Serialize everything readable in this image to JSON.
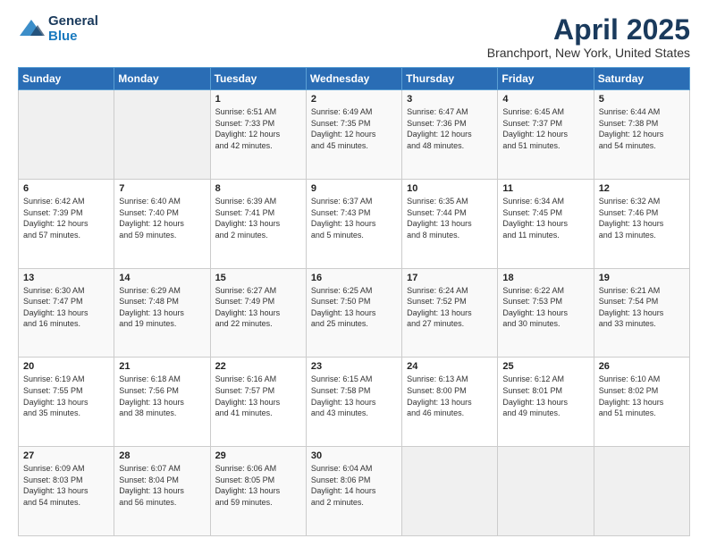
{
  "logo": {
    "general": "General",
    "blue": "Blue"
  },
  "header": {
    "title": "April 2025",
    "subtitle": "Branchport, New York, United States"
  },
  "days_of_week": [
    "Sunday",
    "Monday",
    "Tuesday",
    "Wednesday",
    "Thursday",
    "Friday",
    "Saturday"
  ],
  "weeks": [
    [
      {
        "day": "",
        "info": ""
      },
      {
        "day": "",
        "info": ""
      },
      {
        "day": "1",
        "info": "Sunrise: 6:51 AM\nSunset: 7:33 PM\nDaylight: 12 hours\nand 42 minutes."
      },
      {
        "day": "2",
        "info": "Sunrise: 6:49 AM\nSunset: 7:35 PM\nDaylight: 12 hours\nand 45 minutes."
      },
      {
        "day": "3",
        "info": "Sunrise: 6:47 AM\nSunset: 7:36 PM\nDaylight: 12 hours\nand 48 minutes."
      },
      {
        "day": "4",
        "info": "Sunrise: 6:45 AM\nSunset: 7:37 PM\nDaylight: 12 hours\nand 51 minutes."
      },
      {
        "day": "5",
        "info": "Sunrise: 6:44 AM\nSunset: 7:38 PM\nDaylight: 12 hours\nand 54 minutes."
      }
    ],
    [
      {
        "day": "6",
        "info": "Sunrise: 6:42 AM\nSunset: 7:39 PM\nDaylight: 12 hours\nand 57 minutes."
      },
      {
        "day": "7",
        "info": "Sunrise: 6:40 AM\nSunset: 7:40 PM\nDaylight: 12 hours\nand 59 minutes."
      },
      {
        "day": "8",
        "info": "Sunrise: 6:39 AM\nSunset: 7:41 PM\nDaylight: 13 hours\nand 2 minutes."
      },
      {
        "day": "9",
        "info": "Sunrise: 6:37 AM\nSunset: 7:43 PM\nDaylight: 13 hours\nand 5 minutes."
      },
      {
        "day": "10",
        "info": "Sunrise: 6:35 AM\nSunset: 7:44 PM\nDaylight: 13 hours\nand 8 minutes."
      },
      {
        "day": "11",
        "info": "Sunrise: 6:34 AM\nSunset: 7:45 PM\nDaylight: 13 hours\nand 11 minutes."
      },
      {
        "day": "12",
        "info": "Sunrise: 6:32 AM\nSunset: 7:46 PM\nDaylight: 13 hours\nand 13 minutes."
      }
    ],
    [
      {
        "day": "13",
        "info": "Sunrise: 6:30 AM\nSunset: 7:47 PM\nDaylight: 13 hours\nand 16 minutes."
      },
      {
        "day": "14",
        "info": "Sunrise: 6:29 AM\nSunset: 7:48 PM\nDaylight: 13 hours\nand 19 minutes."
      },
      {
        "day": "15",
        "info": "Sunrise: 6:27 AM\nSunset: 7:49 PM\nDaylight: 13 hours\nand 22 minutes."
      },
      {
        "day": "16",
        "info": "Sunrise: 6:25 AM\nSunset: 7:50 PM\nDaylight: 13 hours\nand 25 minutes."
      },
      {
        "day": "17",
        "info": "Sunrise: 6:24 AM\nSunset: 7:52 PM\nDaylight: 13 hours\nand 27 minutes."
      },
      {
        "day": "18",
        "info": "Sunrise: 6:22 AM\nSunset: 7:53 PM\nDaylight: 13 hours\nand 30 minutes."
      },
      {
        "day": "19",
        "info": "Sunrise: 6:21 AM\nSunset: 7:54 PM\nDaylight: 13 hours\nand 33 minutes."
      }
    ],
    [
      {
        "day": "20",
        "info": "Sunrise: 6:19 AM\nSunset: 7:55 PM\nDaylight: 13 hours\nand 35 minutes."
      },
      {
        "day": "21",
        "info": "Sunrise: 6:18 AM\nSunset: 7:56 PM\nDaylight: 13 hours\nand 38 minutes."
      },
      {
        "day": "22",
        "info": "Sunrise: 6:16 AM\nSunset: 7:57 PM\nDaylight: 13 hours\nand 41 minutes."
      },
      {
        "day": "23",
        "info": "Sunrise: 6:15 AM\nSunset: 7:58 PM\nDaylight: 13 hours\nand 43 minutes."
      },
      {
        "day": "24",
        "info": "Sunrise: 6:13 AM\nSunset: 8:00 PM\nDaylight: 13 hours\nand 46 minutes."
      },
      {
        "day": "25",
        "info": "Sunrise: 6:12 AM\nSunset: 8:01 PM\nDaylight: 13 hours\nand 49 minutes."
      },
      {
        "day": "26",
        "info": "Sunrise: 6:10 AM\nSunset: 8:02 PM\nDaylight: 13 hours\nand 51 minutes."
      }
    ],
    [
      {
        "day": "27",
        "info": "Sunrise: 6:09 AM\nSunset: 8:03 PM\nDaylight: 13 hours\nand 54 minutes."
      },
      {
        "day": "28",
        "info": "Sunrise: 6:07 AM\nSunset: 8:04 PM\nDaylight: 13 hours\nand 56 minutes."
      },
      {
        "day": "29",
        "info": "Sunrise: 6:06 AM\nSunset: 8:05 PM\nDaylight: 13 hours\nand 59 minutes."
      },
      {
        "day": "30",
        "info": "Sunrise: 6:04 AM\nSunset: 8:06 PM\nDaylight: 14 hours\nand 2 minutes."
      },
      {
        "day": "",
        "info": ""
      },
      {
        "day": "",
        "info": ""
      },
      {
        "day": "",
        "info": ""
      }
    ]
  ]
}
